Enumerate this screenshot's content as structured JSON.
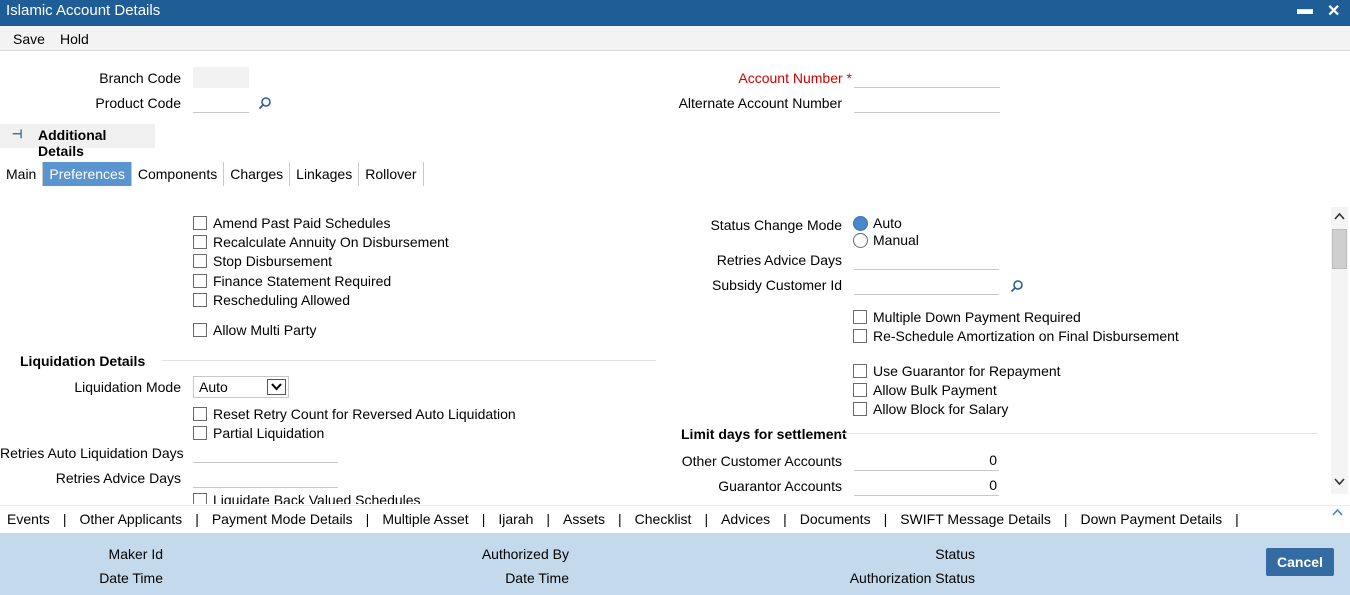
{
  "window": {
    "title": "Islamic Account Details",
    "minimize": "▬",
    "close": "✕"
  },
  "menu": {
    "save": "Save",
    "hold": "Hold"
  },
  "header": {
    "branch_code_label": "Branch Code",
    "product_code_label": "Product Code",
    "account_number_label": "Account Number",
    "account_number_required": "*",
    "alternate_account_label": "Alternate Account Number",
    "additional_details": "Additional Details"
  },
  "tabs": [
    "Main",
    "Preferences",
    "Components",
    "Charges",
    "Linkages",
    "Rollover"
  ],
  "active_tab": "Preferences",
  "preferences": {
    "left_checks": [
      "Amend Past Paid Schedules",
      "Recalculate Annuity On Disbursement",
      "Stop Disbursement",
      "Finance Statement Required",
      "Rescheduling Allowed"
    ],
    "allow_multi_party": "Allow Multi Party",
    "status_change_mode_label": "Status Change Mode",
    "status_options": [
      "Auto",
      "Manual"
    ],
    "status_selected": "Auto",
    "retries_advice_days_label": "Retries Advice Days",
    "subsidy_customer_id_label": "Subsidy Customer Id",
    "right_checks_a": [
      "Multiple Down Payment Required",
      "Re-Schedule Amortization on Final Disbursement"
    ],
    "right_checks_b": [
      "Use Guarantor for Repayment",
      "Allow Bulk Payment",
      "Allow Block for Salary"
    ]
  },
  "liquidation": {
    "section_title": "Liquidation Details",
    "mode_label": "Liquidation Mode",
    "mode_value": "Auto",
    "checks": [
      "Reset Retry Count for Reversed Auto Liquidation",
      "Partial Liquidation"
    ],
    "retries_auto_label": "Retries Auto Liquidation Days",
    "retries_advice_label": "Retries Advice Days",
    "liquidate_back_valued": "Liquidate Back Valued Schedules"
  },
  "limit_days": {
    "section_title": "Limit days for settlement",
    "other_customer_label": "Other Customer Accounts",
    "other_customer_value": "0",
    "guarantor_label": "Guarantor Accounts",
    "guarantor_value": "0"
  },
  "bottom_links": [
    "Events",
    "Other Applicants",
    "Payment Mode Details",
    "Multiple Asset",
    "Ijarah",
    "Assets",
    "Checklist",
    "Advices",
    "Documents",
    "SWIFT Message Details",
    "Down Payment Details"
  ],
  "footer": {
    "maker_id": "Maker Id",
    "date_time": "Date Time",
    "authorized_by": "Authorized By",
    "date_time_2": "Date Time",
    "status": "Status",
    "authorization_status": "Authorization Status",
    "cancel": "Cancel"
  },
  "colors": {
    "titlebar": "#1f5d96",
    "active_tab": "#5b95cf",
    "footer": "#c4d9ec",
    "cancel_button": "#356ba3",
    "required": "#d40000"
  }
}
